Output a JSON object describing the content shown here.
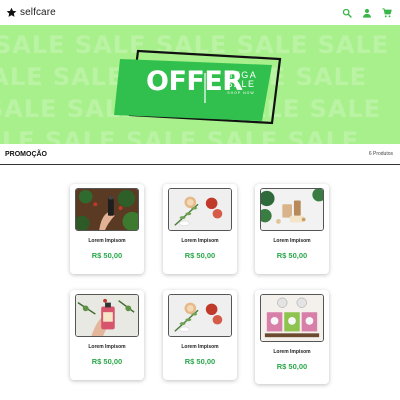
{
  "header": {
    "brand_name": "selfcare",
    "brand_icon": "star-icon",
    "actions": [
      "search-icon",
      "user-icon",
      "cart-icon"
    ],
    "accent": "#39b54a"
  },
  "banner": {
    "offer": "OFFER",
    "mega": "MEGA",
    "sale": "SALE",
    "shop_now": "SHOP NOW",
    "background_word": "SALE",
    "background_color": "#a8f08c",
    "tag_color": "#31c04d"
  },
  "section": {
    "title": "PROMOÇÃO",
    "count": "6 Produtos"
  },
  "products": [
    {
      "name": "Lorem Impisom",
      "price": "R$ 50,00"
    },
    {
      "name": "Lorem Impisom",
      "price": "R$ 50,00"
    },
    {
      "name": "Lorem Impisom",
      "price": "R$ 50,00"
    },
    {
      "name": "Lorem Impisom",
      "price": "R$ 50,00"
    },
    {
      "name": "Lorem Impisom",
      "price": "R$ 50,00"
    },
    {
      "name": "Lorem Impisom",
      "price": "R$ 50,00"
    }
  ],
  "price_color": "#2aa84a"
}
